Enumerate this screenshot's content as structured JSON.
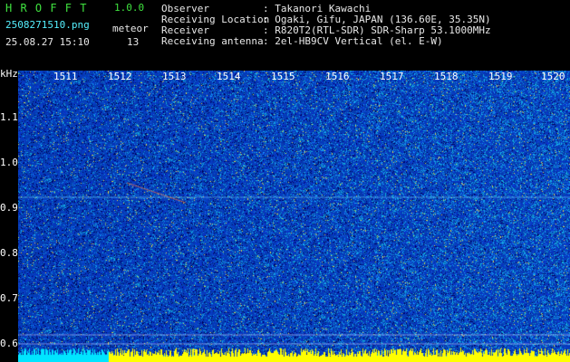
{
  "app": {
    "title": "H R O F F T",
    "version": "1.0.0",
    "filename": "2508271510.png",
    "date_time": "25.08.27 15:10",
    "category_label": "meteor",
    "count": "13"
  },
  "info": {
    "rows": [
      {
        "label": "Observer",
        "value": ": Takanori Kawachi"
      },
      {
        "label": "Receiving Location",
        "value": ": Ogaki, Gifu, JAPAN (136.60E, 35.35N)"
      },
      {
        "label": "Receiver",
        "value": ": R820T2(RTL-SDR) SDR-Sharp 53.1000MHz"
      },
      {
        "label": "Receiving antenna",
        "value": ": 2el-HB9CV Vertical (el. E-W)"
      }
    ]
  },
  "axes": {
    "y_unit": "kHz",
    "y_ticks": [
      "1.1",
      "1.0",
      "0.9",
      "0.8",
      "0.7",
      "0.6"
    ],
    "x_ticks": [
      "1511",
      "1512",
      "1513",
      "1514",
      "1515",
      "1516",
      "1517",
      "1518",
      "1519",
      "1520"
    ]
  },
  "colors": {
    "background": "#000000",
    "header_green": "#3fe23f",
    "header_cyan": "#55f0ff",
    "spectrogram_base": "#1a2a8a",
    "baseline_yellow": "#ffff00"
  }
}
